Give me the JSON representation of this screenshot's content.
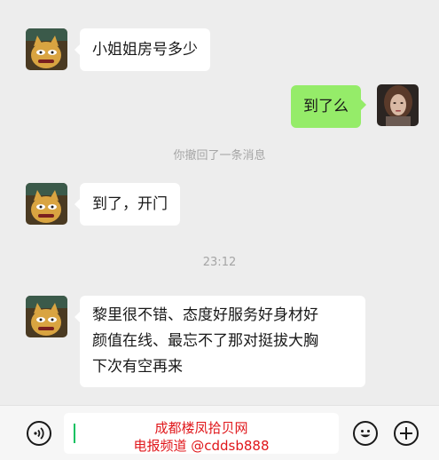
{
  "messages": [
    {
      "side": "in",
      "text": "小姐姐房号多少",
      "avatar": "cat-avatar-icon"
    },
    {
      "side": "out",
      "text": "到了么",
      "avatar": "woman-avatar-icon"
    },
    {
      "system": "你撤回了一条消息"
    },
    {
      "side": "in",
      "text": "到了，开门",
      "avatar": "cat-avatar-icon"
    },
    {
      "timestamp": "23:12"
    },
    {
      "side": "in",
      "lines": [
        "黎里很不错、态度好服务好身材好",
        "颜值在线、最忘不了那对挺拔大胸",
        "下次有空再来"
      ],
      "avatar": "cat-avatar-icon"
    }
  ],
  "input_bar": {
    "voice_icon": "voice-icon",
    "emoji_icon": "emoji-icon",
    "plus_icon": "plus-icon",
    "watermark_line1": "成都楼凤拾贝网",
    "watermark_line2": "电报频道 @cddsb888",
    "cursor_color": "#07c160"
  },
  "colors": {
    "background": "#ededed",
    "incoming_bubble": "#ffffff",
    "outgoing_bubble": "#95ec69",
    "watermark": "#e0161a"
  }
}
